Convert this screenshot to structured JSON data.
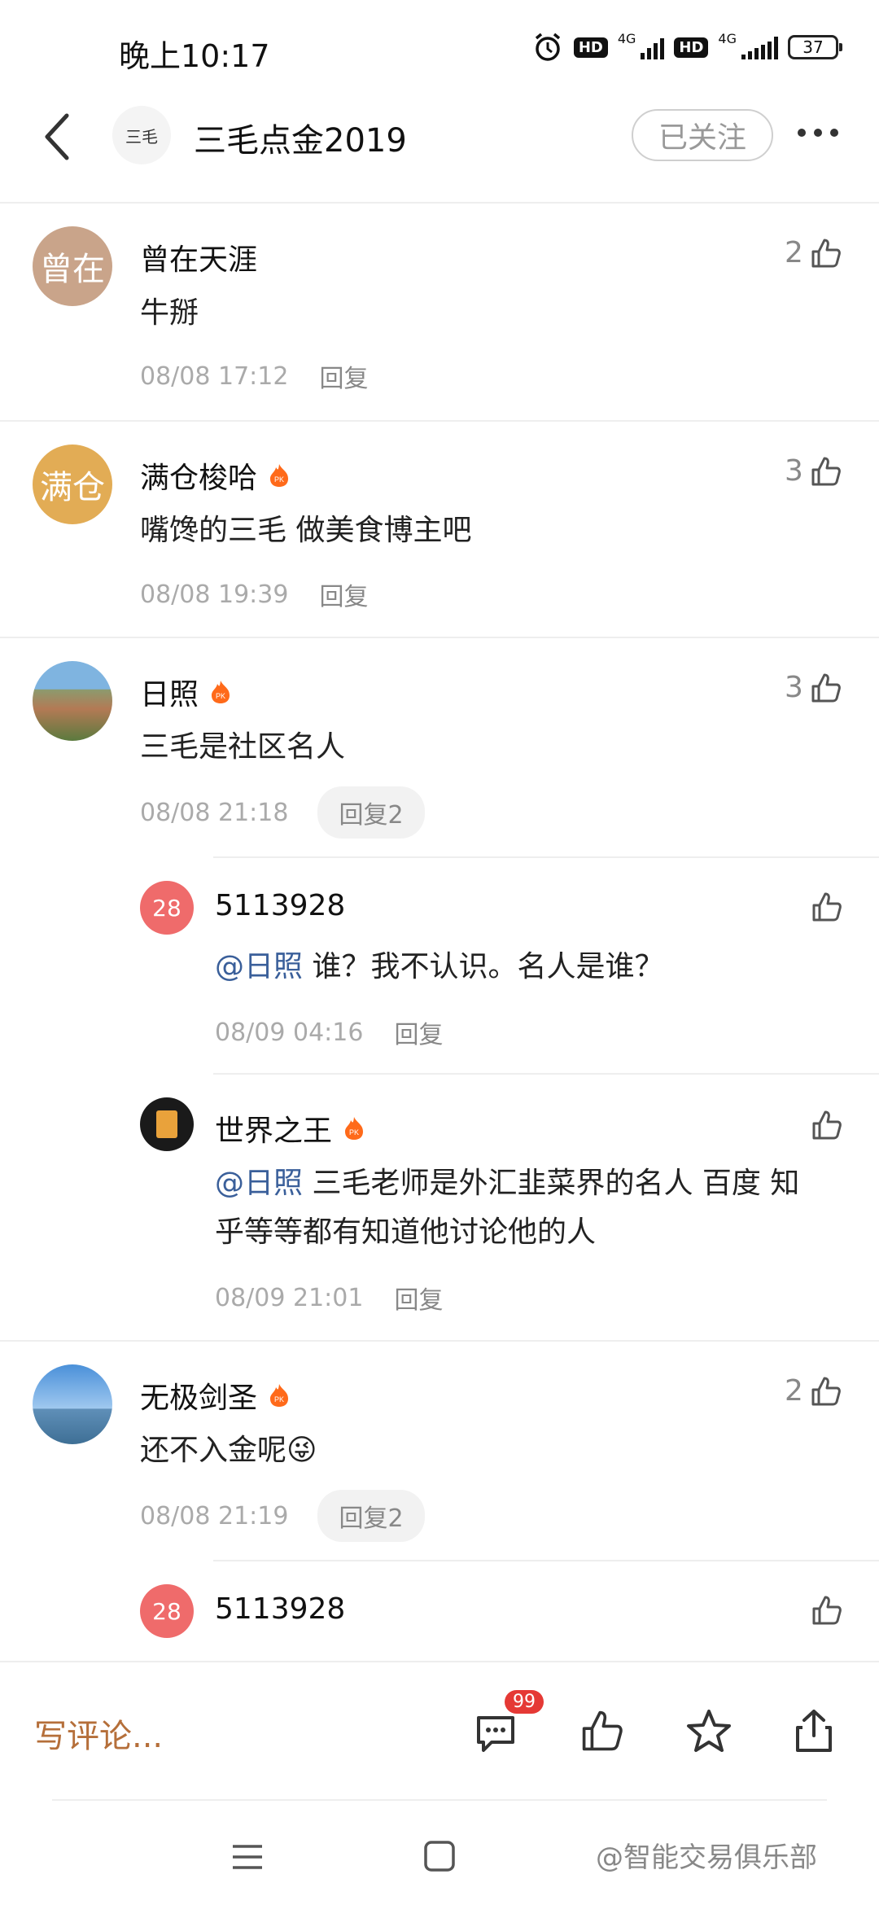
{
  "status_bar": {
    "time": "晚上10:17",
    "net1": "4G",
    "net2": "4G",
    "battery": "37",
    "hd": "HD"
  },
  "header": {
    "title": "三毛点金2019",
    "follow_label": "已关注",
    "avatar_text": "三毛"
  },
  "comments": [
    {
      "avatar_text": "曾在",
      "avatar_color": "#c9a48a",
      "name": "曾在天涯",
      "text": "牛掰",
      "time": "08/08 17:12",
      "reply": "回复",
      "likes": "2"
    },
    {
      "avatar_text": "满仓",
      "avatar_color": "#e2ac55",
      "name": "满仓梭哈",
      "text": "嘴馋的三毛 做美食博主吧",
      "time": "08/08 19:39",
      "reply": "回复",
      "likes": "3"
    },
    {
      "name": "日照",
      "text": "三毛是社区名人",
      "time": "08/08 21:18",
      "reply": "回复2",
      "likes": "3"
    },
    {
      "name": "无极剑圣",
      "text": "还不入金呢😜",
      "time": "08/08 21:19",
      "reply": "回复2",
      "likes": "2"
    }
  ],
  "replies": [
    {
      "avatar_text": "28",
      "avatar_color": "#ef6b6b",
      "name": "5113928",
      "mention": "@日照",
      "text": "谁？我不认识。名人是谁？",
      "time": "08/09 04:16",
      "reply": "回复"
    },
    {
      "name": "世界之王",
      "mention": "@日照",
      "text_line1": "三毛老师是外汇韭菜界的名人 百度 知",
      "text_line2": "乎等等都有知道他讨论他的人",
      "time": "08/09 21:01",
      "reply": "回复"
    },
    {
      "avatar_text": "28",
      "avatar_color": "#ef6b6b",
      "name": "5113928"
    }
  ],
  "bottom_bar": {
    "write_placeholder": "写评论...",
    "comment_count": "99"
  },
  "watermark": "@智能交易俱乐部"
}
